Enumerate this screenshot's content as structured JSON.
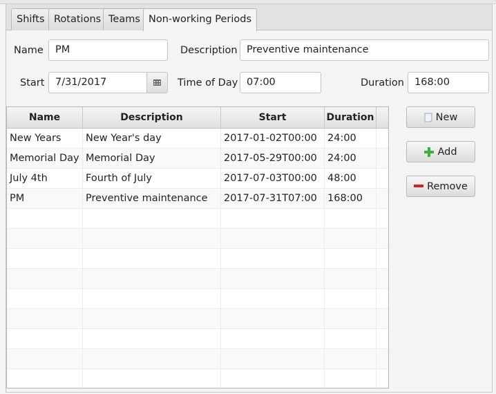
{
  "tabs": [
    {
      "label": "Shifts"
    },
    {
      "label": "Rotations"
    },
    {
      "label": "Teams"
    },
    {
      "label": "Non-working Periods",
      "active": true
    }
  ],
  "form": {
    "name_label": "Name",
    "name_value": "PM",
    "description_label": "Description",
    "description_value": "Preventive maintenance",
    "start_label": "Start",
    "start_value": "7/31/2017",
    "time_label": "Time of Day",
    "time_value": "07:00",
    "duration_label": "Duration",
    "duration_value": "168:00"
  },
  "table": {
    "columns": [
      "Name",
      "Description",
      "Start",
      "Duration"
    ],
    "rows": [
      [
        "New Years",
        "New Year's day",
        "2017-01-02T00:00",
        "24:00"
      ],
      [
        "Memorial Day",
        "Memorial Day",
        "2017-05-29T00:00",
        "24:00"
      ],
      [
        "July 4th",
        "Fourth of July",
        "2017-07-03T00:00",
        "48:00"
      ],
      [
        "PM",
        "Preventive maintenance",
        "2017-07-31T07:00",
        "168:00"
      ]
    ]
  },
  "buttons": {
    "new": "New",
    "add": "Add",
    "remove": "Remove"
  },
  "colors": {
    "add_icon": "#3cb043",
    "remove_icon": "#d22020"
  }
}
